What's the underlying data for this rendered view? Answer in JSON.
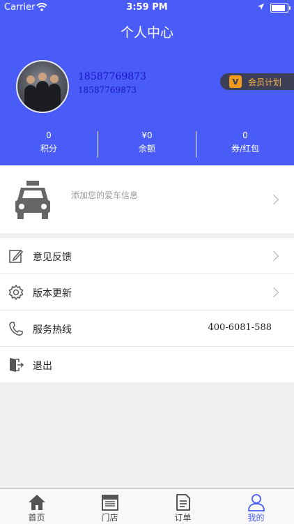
{
  "statusbar": {
    "carrier": "Carrier",
    "time": "3:59 PM"
  },
  "header": {
    "title": "个人中心",
    "phone_primary": "18587769873",
    "phone_secondary": "18587769873",
    "vip_label": "会员计划",
    "vip_icon_letter": "v"
  },
  "stats": [
    {
      "value": "0",
      "label": "积分"
    },
    {
      "value": "¥0",
      "label": "余额"
    },
    {
      "value": "0",
      "label": "券/红包"
    }
  ],
  "car": {
    "hint": "添加您的爱车信息"
  },
  "menu": [
    {
      "label": "意见反馈",
      "icon": "edit-icon"
    },
    {
      "label": "版本更新",
      "icon": "gear-icon"
    },
    {
      "label": "服务热线",
      "value": "400-6081-588",
      "icon": "phone-icon"
    },
    {
      "label": "退出",
      "icon": "logout-icon"
    }
  ],
  "tabbar": [
    {
      "label": "首页",
      "icon": "home-icon"
    },
    {
      "label": "门店",
      "icon": "store-icon"
    },
    {
      "label": "订单",
      "icon": "order-icon"
    },
    {
      "label": "我的",
      "icon": "user-icon",
      "active": true
    }
  ],
  "colors": {
    "primary": "#4a5cf7",
    "phone_text": "#1a10c8",
    "vip_bg": "#3c3f55",
    "vip_text": "#f3b04a"
  }
}
